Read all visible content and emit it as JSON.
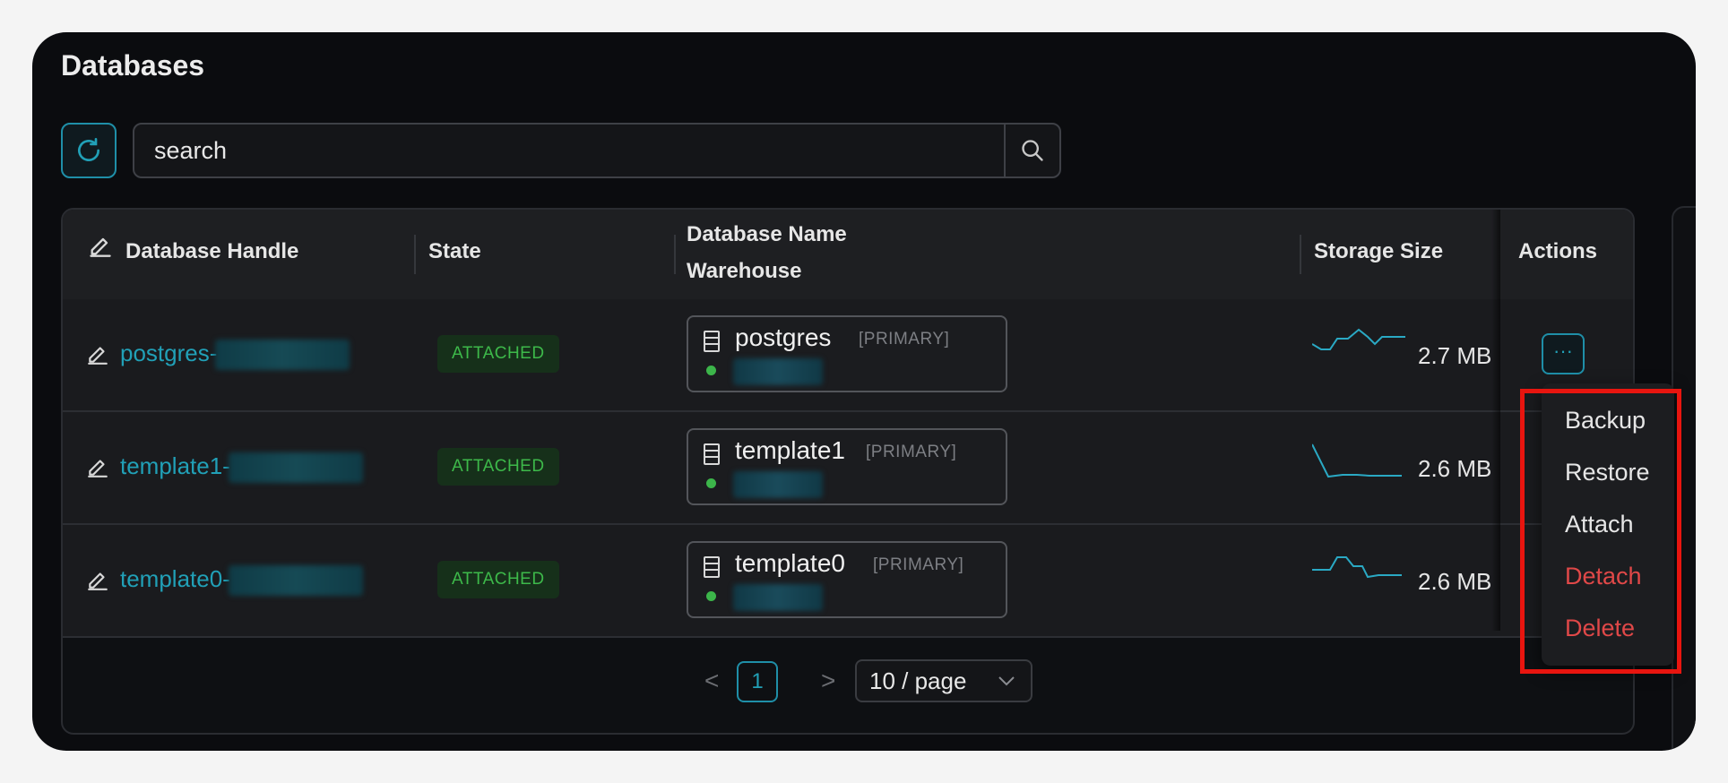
{
  "page": {
    "title": "Databases"
  },
  "search": {
    "placeholder": "search",
    "value": ""
  },
  "table": {
    "columns": {
      "handle": "Database Handle",
      "state": "State",
      "db_name": "Database Name",
      "warehouse": "Warehouse",
      "storage": "Storage Size",
      "actions": "Actions"
    },
    "rows": [
      {
        "handle_prefix": "postgres-",
        "state": "ATTACHED",
        "db_name": "postgres",
        "role": "[PRIMARY]",
        "storage": "2.7 MB"
      },
      {
        "handle_prefix": "template1-",
        "state": "ATTACHED",
        "db_name": "template1",
        "role": "[PRIMARY]",
        "storage": "2.6 MB"
      },
      {
        "handle_prefix": "template0-",
        "state": "ATTACHED",
        "db_name": "template0",
        "role": "[PRIMARY]",
        "storage": "2.6 MB"
      }
    ],
    "actions_button_glyph": "···"
  },
  "pagination": {
    "prev": "<",
    "current": "1",
    "next": ">",
    "page_size": "10 / page"
  },
  "menu": {
    "items": [
      {
        "label": "Backup",
        "danger": false
      },
      {
        "label": "Restore",
        "danger": false
      },
      {
        "label": "Attach",
        "danger": false
      },
      {
        "label": "Detach",
        "danger": true
      },
      {
        "label": "Delete",
        "danger": true
      }
    ]
  },
  "colors": {
    "accent": "#21a0b7",
    "state_green": "#3db94a",
    "danger": "#e04848",
    "highlight_box": "#e8150f",
    "window_bg": "#0b0c0f"
  },
  "icons": {
    "refresh": "refresh-icon",
    "search": "search-icon",
    "edit": "edit-icon",
    "database": "database-icon",
    "more": "more-icon",
    "chevron_down": "chevron-down-icon"
  }
}
